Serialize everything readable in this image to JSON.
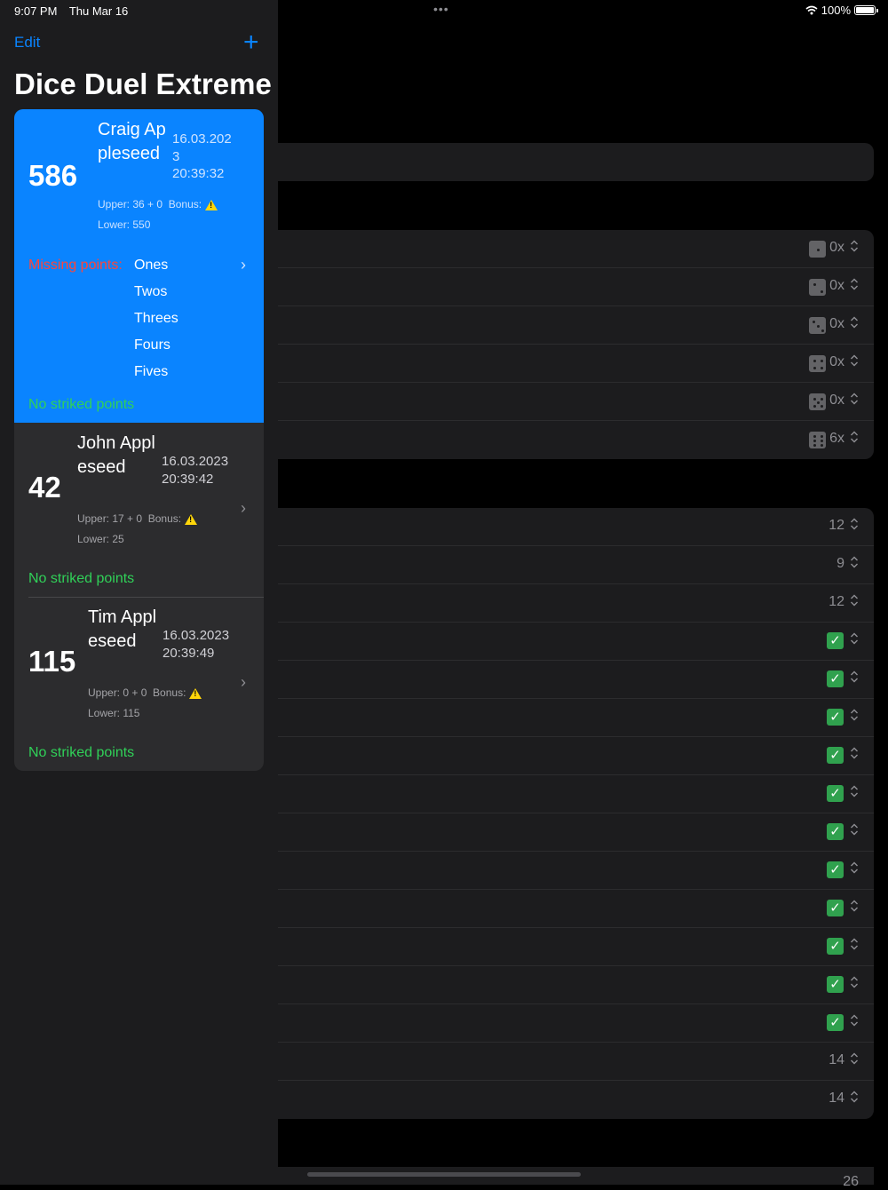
{
  "status": {
    "time": "9:07 PM",
    "date": "Thu Mar 16",
    "dots": "•••",
    "battery": "100%"
  },
  "sidebar": {
    "edit_label": "Edit",
    "add_label": "+",
    "title": "Dice Duel Extreme",
    "games": [
      {
        "score": "586",
        "name": "Craig Appleseed",
        "date": "16.03.2023",
        "time": "20:39:32",
        "upper": "Upper: 36 + 0",
        "bonus": "Bonus:",
        "lower": "Lower: 550",
        "missing_label": "Missing points:",
        "missing": [
          "Ones",
          "Twos",
          "Threes",
          "Fours",
          "Fives"
        ],
        "striked": "No striked points",
        "selected": true
      },
      {
        "score": "42",
        "name": "John Appleseed",
        "date": "16.03.2023",
        "time": "20:39:42",
        "upper": "Upper: 17 + 0",
        "bonus": "Bonus:",
        "lower": "Lower: 25",
        "striked": "No striked points"
      },
      {
        "score": "115",
        "name": "Tim Appleseed",
        "date": "16.03.2023",
        "time": "20:39:49",
        "upper": "Upper: 0 + 0",
        "bonus": "Bonus:",
        "lower": "Lower: 115",
        "striked": "No striked points"
      }
    ]
  },
  "detail": {
    "upper_rows": [
      {
        "die": 1,
        "value": "0x"
      },
      {
        "die": 2,
        "value": "0x"
      },
      {
        "die": 3,
        "value": "0x"
      },
      {
        "die": 4,
        "value": "0x"
      },
      {
        "die": 5,
        "value": "0x"
      },
      {
        "die": 6,
        "value": "6x"
      }
    ],
    "lower_rows": [
      {
        "value": "12"
      },
      {
        "value": "9"
      },
      {
        "value": "12"
      },
      {
        "check": true
      },
      {
        "check": true
      },
      {
        "check": true
      },
      {
        "check": true
      },
      {
        "check": true
      },
      {
        "check": true
      },
      {
        "check": true
      },
      {
        "check": true
      },
      {
        "check": true
      },
      {
        "check": true
      },
      {
        "check": true
      },
      {
        "value": "14"
      },
      {
        "value": "14"
      }
    ],
    "partial_value": "26",
    "check_glyph": "✓",
    "stepper_glyph": "⌃⌄"
  }
}
